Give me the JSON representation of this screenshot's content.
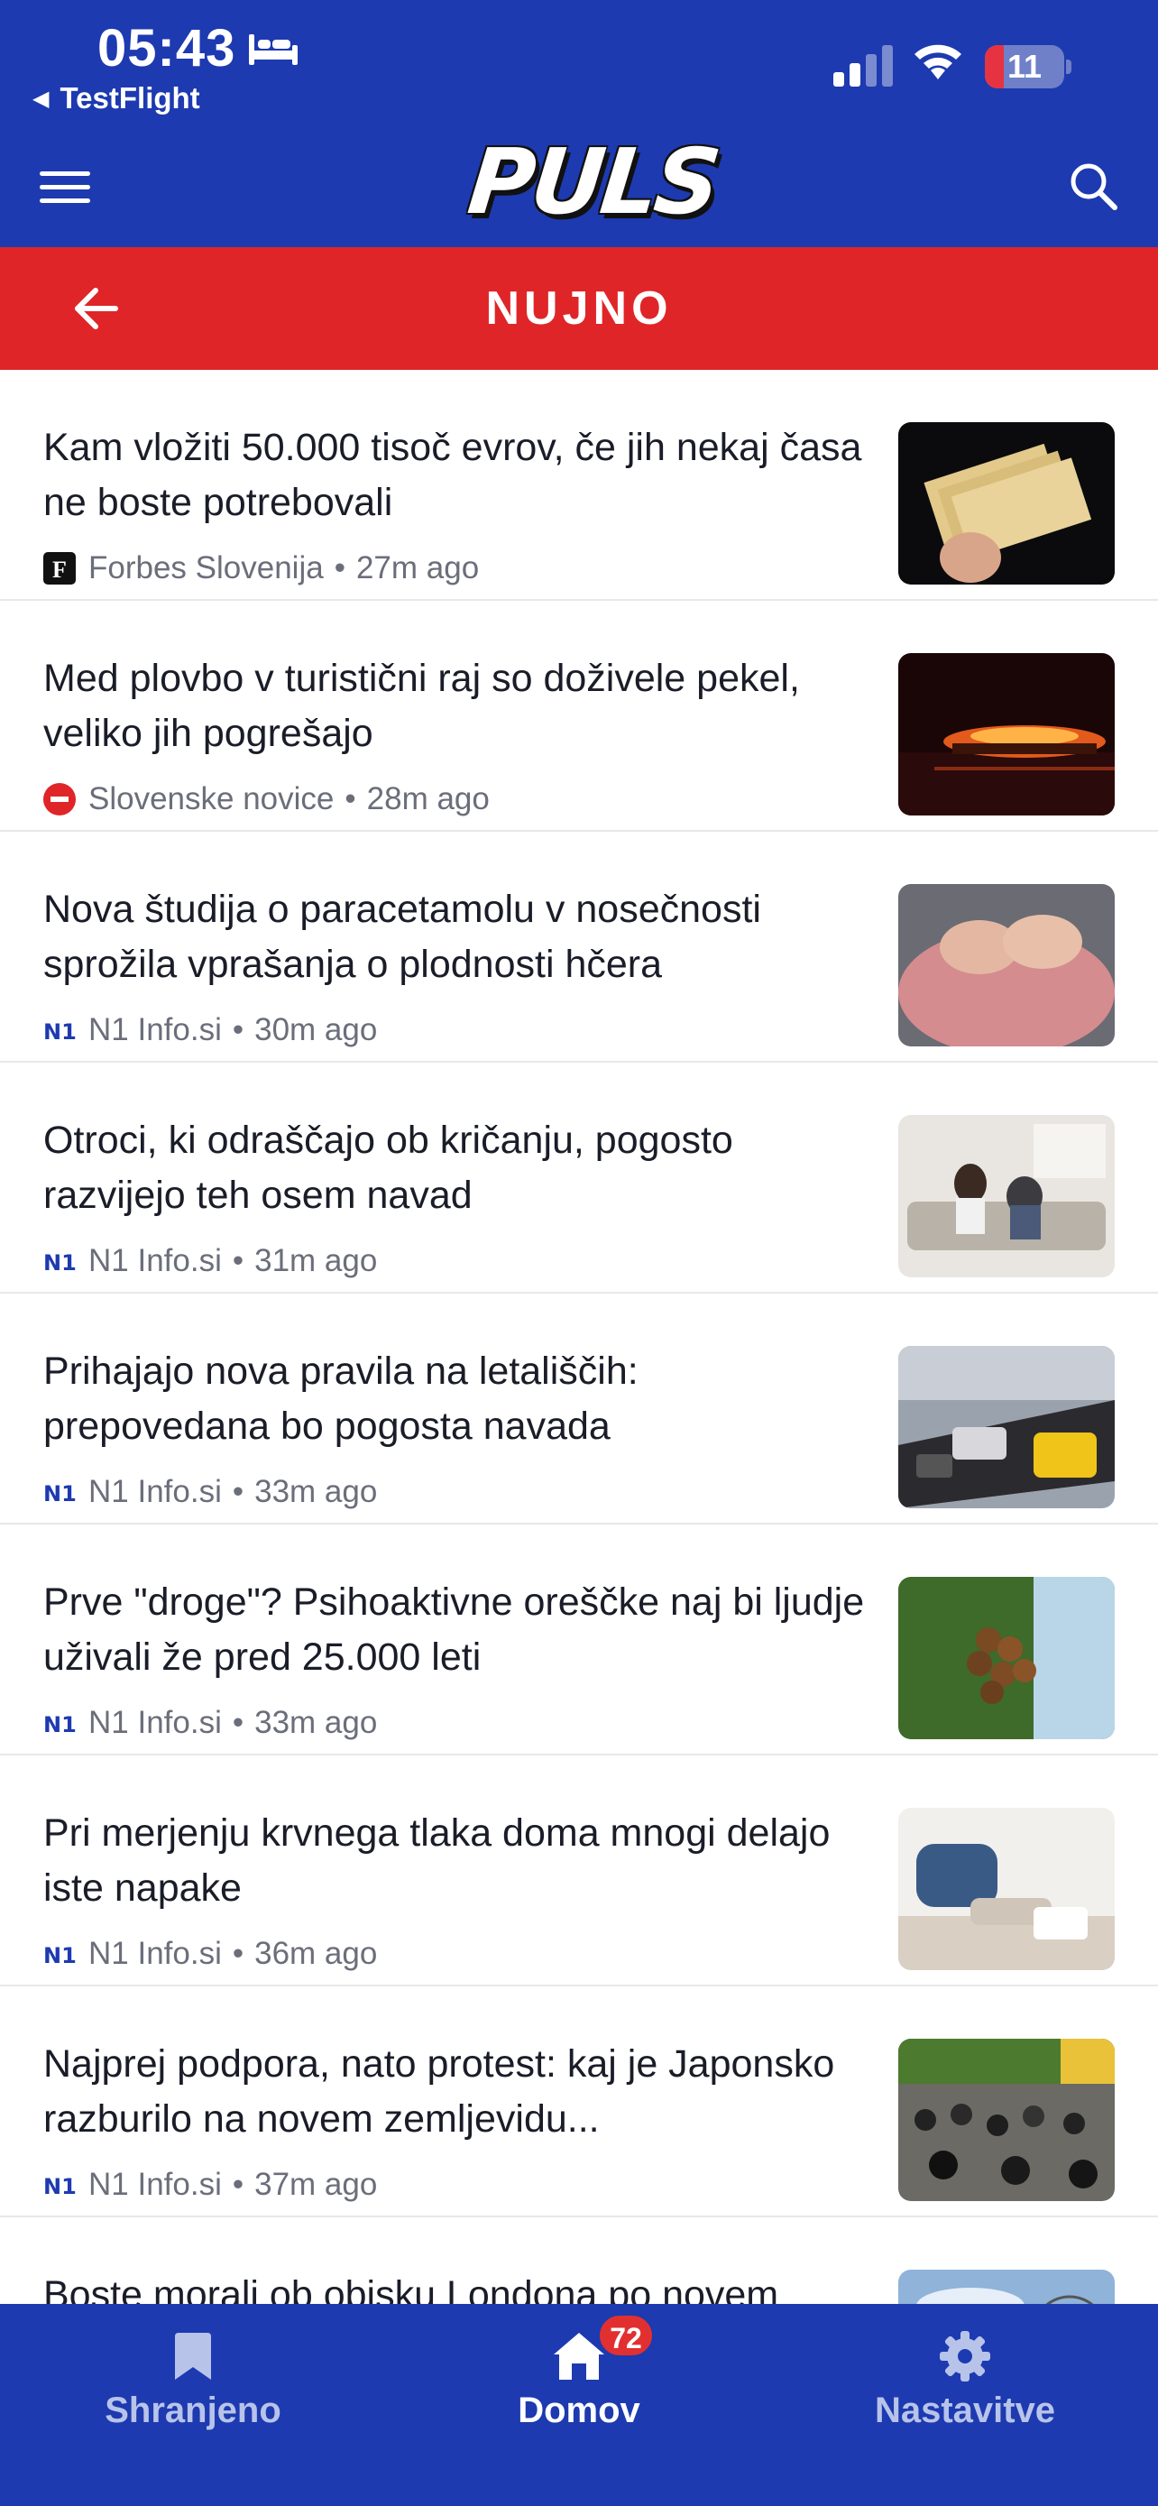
{
  "status_bar": {
    "time": "05:43",
    "back_app": "TestFlight",
    "battery": "11",
    "battery_level": 0.11
  },
  "header": {
    "logo": "PULS",
    "section_title": "NUJNO"
  },
  "colors": {
    "brand_blue": "#1d3ab0",
    "section_red": "#e02528",
    "badge_red": "#e23030"
  },
  "articles": [
    {
      "title": "Kam vložiti 50.000 tisoč evrov, če jih nekaj časa ne boste potrebovali",
      "source": "Forbes Slovenija",
      "time": "27m ago",
      "source_icon": "forbes-icon",
      "thumb_icon": "banknotes-photo"
    },
    {
      "title": "Med plovbo v turistični raj so doživele pekel, veliko jih pogrešajo",
      "source": "Slovenske novice",
      "time": "28m ago",
      "source_icon": "slovenske-novice-icon",
      "thumb_icon": "ship-fire-photo"
    },
    {
      "title": "Nova študija o paracetamolu v nosečnosti sprožila vprašanja o plodnosti hčera",
      "source": "N1 Info.si",
      "time": "30m ago",
      "source_icon": "n1-icon",
      "thumb_icon": "pregnant-belly-photo"
    },
    {
      "title": "Otroci, ki odraščajo ob kričanju, pogosto razvijejo teh osem navad",
      "source": "N1 Info.si",
      "time": "31m ago",
      "source_icon": "n1-icon",
      "thumb_icon": "couple-sofa-photo"
    },
    {
      "title": "Prihajajo nova pravila na letališčih: prepovedana bo pogosta navada",
      "source": "N1 Info.si",
      "time": "33m ago",
      "source_icon": "n1-icon",
      "thumb_icon": "airport-luggage-photo"
    },
    {
      "title": "Prve \"droge\"? Psihoaktivne oreščke naj bi ljudje uživali že pred 25.000 leti",
      "source": "N1 Info.si",
      "time": "33m ago",
      "source_icon": "n1-icon",
      "thumb_icon": "palm-nuts-photo"
    },
    {
      "title": "Pri merjenju krvnega tlaka doma mnogi delajo iste napake",
      "source": "N1 Info.si",
      "time": "36m ago",
      "source_icon": "n1-icon",
      "thumb_icon": "blood-pressure-photo"
    },
    {
      "title": "Najprej podpora, nato protest: kaj je Japonsko razburilo na novem zemljevidu...",
      "source": "N1 Info.si",
      "time": "37m ago",
      "source_icon": "n1-icon",
      "thumb_icon": "crowd-street-photo"
    },
    {
      "title": "Boste morali ob obisku Londona po novem",
      "source": "",
      "time": "",
      "source_icon": "",
      "thumb_icon": "london-sky-photo"
    }
  ],
  "tabs": [
    {
      "label": "Shranjeno",
      "icon": "bookmark-icon",
      "active": false
    },
    {
      "label": "Domov",
      "icon": "home-icon",
      "active": true,
      "badge": "72"
    },
    {
      "label": "Nastavitve",
      "icon": "gear-icon",
      "active": false
    }
  ]
}
